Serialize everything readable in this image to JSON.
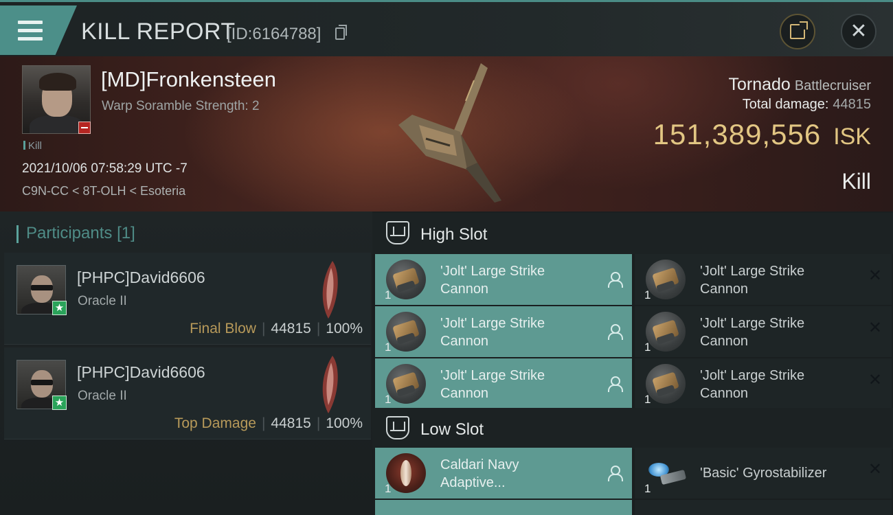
{
  "header": {
    "title": "KILL REPORT",
    "report_id": "[ID:6164788]"
  },
  "victim": {
    "name": "[MD]Fronkensteen",
    "subtitle": "Warp Soramble Strength: 2",
    "kill_tag": "Kill",
    "datetime": "2021/10/06 07:58:29 UTC -7",
    "location": "C9N-CC < 8T-OLH < Esoteria"
  },
  "ship": {
    "name": "Tornado",
    "class": "Battlecruiser",
    "total_damage_label": "Total damage:",
    "total_damage": "44815",
    "isk_value": "151,389,556",
    "isk_unit": "ISK",
    "result": "Kill"
  },
  "participants": {
    "title": "Participants",
    "count": "[1]",
    "items": [
      {
        "name": "[PHPC]David6606",
        "ship": "Oracle II",
        "role": "Final Blow",
        "damage": "44815",
        "percent": "100%"
      },
      {
        "name": "[PHPC]David6606",
        "ship": "Oracle II",
        "role": "Top Damage",
        "damage": "44815",
        "percent": "100%"
      }
    ]
  },
  "fitting": {
    "high_slot_title": "High Slot",
    "low_slot_title": "Low Slot",
    "high_items": [
      {
        "name": "'Jolt' Large Strike Cannon",
        "qty": "1",
        "status": "equipped",
        "icon": "cannon-icon"
      },
      {
        "name": "'Jolt' Large Strike Cannon",
        "qty": "1",
        "status": "destroyed",
        "icon": "cannon-icon"
      },
      {
        "name": "'Jolt' Large Strike Cannon",
        "qty": "1",
        "status": "equipped",
        "icon": "cannon-icon"
      },
      {
        "name": "'Jolt' Large Strike Cannon",
        "qty": "1",
        "status": "destroyed",
        "icon": "cannon-icon"
      },
      {
        "name": "'Jolt' Large Strike Cannon",
        "qty": "1",
        "status": "equipped",
        "icon": "cannon-icon"
      },
      {
        "name": "'Jolt' Large Strike Cannon",
        "qty": "1",
        "status": "destroyed",
        "icon": "cannon-icon"
      }
    ],
    "low_items": [
      {
        "name": "Caldari Navy Adaptive...",
        "qty": "1",
        "status": "equipped",
        "icon": "armor-plate-icon"
      },
      {
        "name": "'Basic' Gyrostabilizer",
        "qty": "1",
        "status": "destroyed",
        "icon": "gyrostabilizer-icon"
      }
    ]
  },
  "colors": {
    "accent_teal": "#5e9a92",
    "isk_gold": "#e2c683",
    "role_gold": "#b89a5a",
    "badge_green": "#2aa35a",
    "badge_red": "#b52622"
  }
}
